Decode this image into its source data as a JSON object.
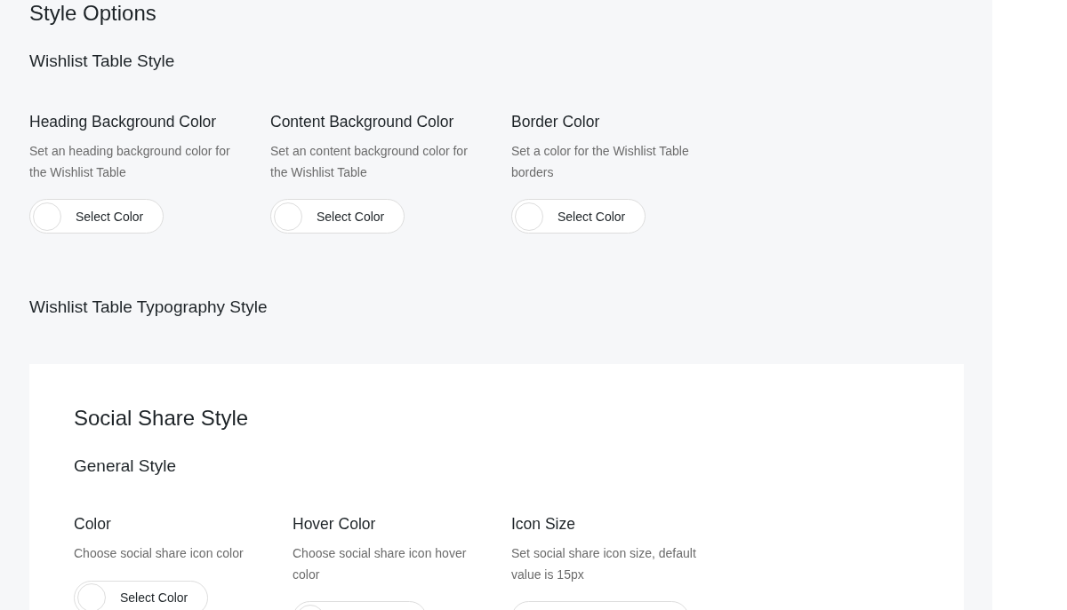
{
  "title": "Style Options",
  "sections": [
    {
      "heading": "Wishlist Table Style",
      "options": [
        {
          "label": "Heading Background Color",
          "description": "Set an heading background color for the Wishlist Table",
          "control": {
            "kind": "color",
            "text": "Select Color"
          }
        },
        {
          "label": "Content Background Color",
          "description": "Set an content background color for the Wishlist Table",
          "control": {
            "kind": "color",
            "text": "Select Color"
          }
        },
        {
          "label": "Border Color",
          "description": "Set a color for the Wishlist Table borders",
          "control": {
            "kind": "color",
            "text": "Select Color"
          }
        }
      ]
    },
    {
      "heading": "Wishlist Table Typography Style"
    }
  ],
  "card": {
    "title": "Social Share Style",
    "sections": [
      {
        "heading": "General Style",
        "options": [
          {
            "label": "Color",
            "description": "Choose social share icon color",
            "control": {
              "kind": "color",
              "text": "Select Color"
            }
          },
          {
            "label": "Hover Color",
            "description": "Choose social share icon hover color",
            "control": {
              "kind": "color"
            }
          },
          {
            "label": "Icon Size",
            "description": "Set social share icon size, default value is 15px",
            "control": {
              "kind": "number"
            }
          }
        ]
      }
    ]
  }
}
